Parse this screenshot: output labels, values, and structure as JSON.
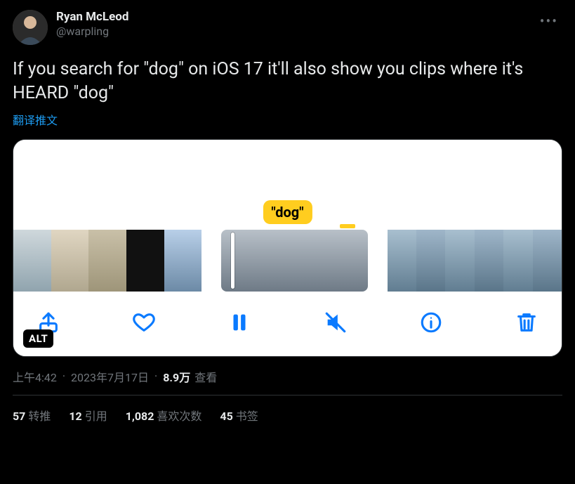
{
  "author": {
    "display_name": "Ryan McLeod",
    "handle": "@warpling"
  },
  "more_icon": "more-icon",
  "body_text": "If you search for \"dog\" on iOS 17 it'll also show you clips where it's HEARD \"dog\"",
  "translate_label": "翻译推文",
  "media": {
    "search_term": "\"dog\"",
    "alt_badge": "ALT",
    "toolbar": {
      "share": "share-icon",
      "like": "heart-icon",
      "pause": "pause-icon",
      "mute": "mute-icon",
      "info": "info-icon",
      "trash": "trash-icon"
    }
  },
  "meta": {
    "time": "上午4:42",
    "date": "2023年7月17日",
    "views_number": "8.9万",
    "views_label": "查看"
  },
  "stats": {
    "retweets_num": "57",
    "retweets_label": "转推",
    "quotes_num": "12",
    "quotes_label": "引用",
    "likes_num": "1,082",
    "likes_label": "喜欢次数",
    "bookmarks_num": "45",
    "bookmarks_label": "书签"
  }
}
